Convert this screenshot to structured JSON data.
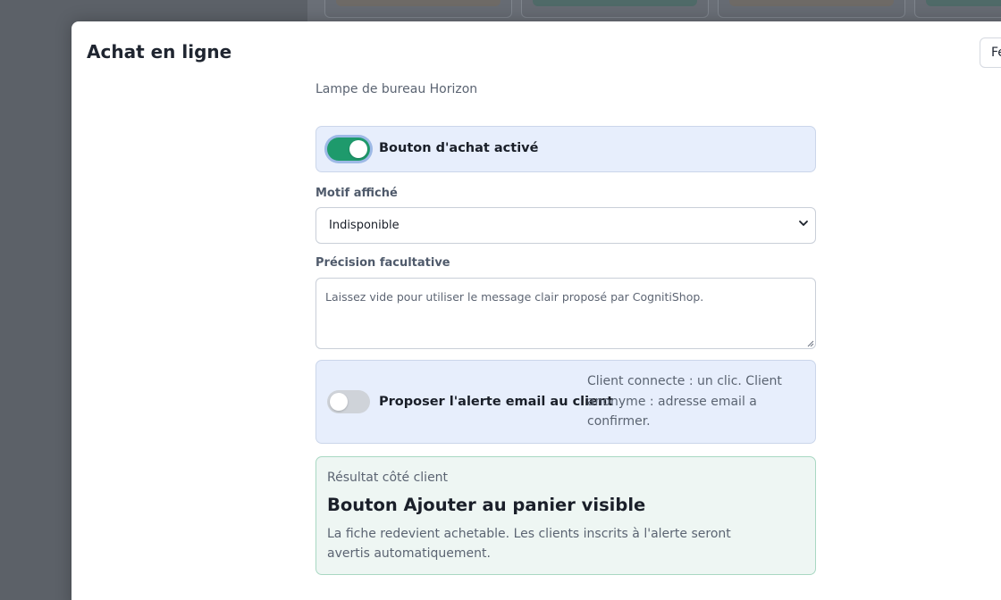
{
  "modal": {
    "title": "Achat en ligne",
    "close_label": "Fermer"
  },
  "product": {
    "name": "Lampe de bureau Horizon"
  },
  "purchase_toggle": {
    "label": "Bouton d'achat activé",
    "checked": true,
    "color_on": "#1e9a6c"
  },
  "reason": {
    "label": "Motif affiché",
    "selected": "Indisponible"
  },
  "precision": {
    "label": "Précision facultative",
    "placeholder": "Laissez vide pour utiliser le message clair proposé par CognitiShop."
  },
  "alert_toggle": {
    "label": "Proposer l'alerte email au client",
    "checked": false,
    "hint": "Client connecte : un clic. Client anonyme : adresse email a confirmer."
  },
  "result": {
    "caption": "Résultat côté client",
    "heading": "Bouton Ajouter au panier visible",
    "description": "La fiche redevient achetable. Les clients inscrits à l'alerte seront avertis automatiquement.",
    "border_color": "#a9d8c3"
  }
}
